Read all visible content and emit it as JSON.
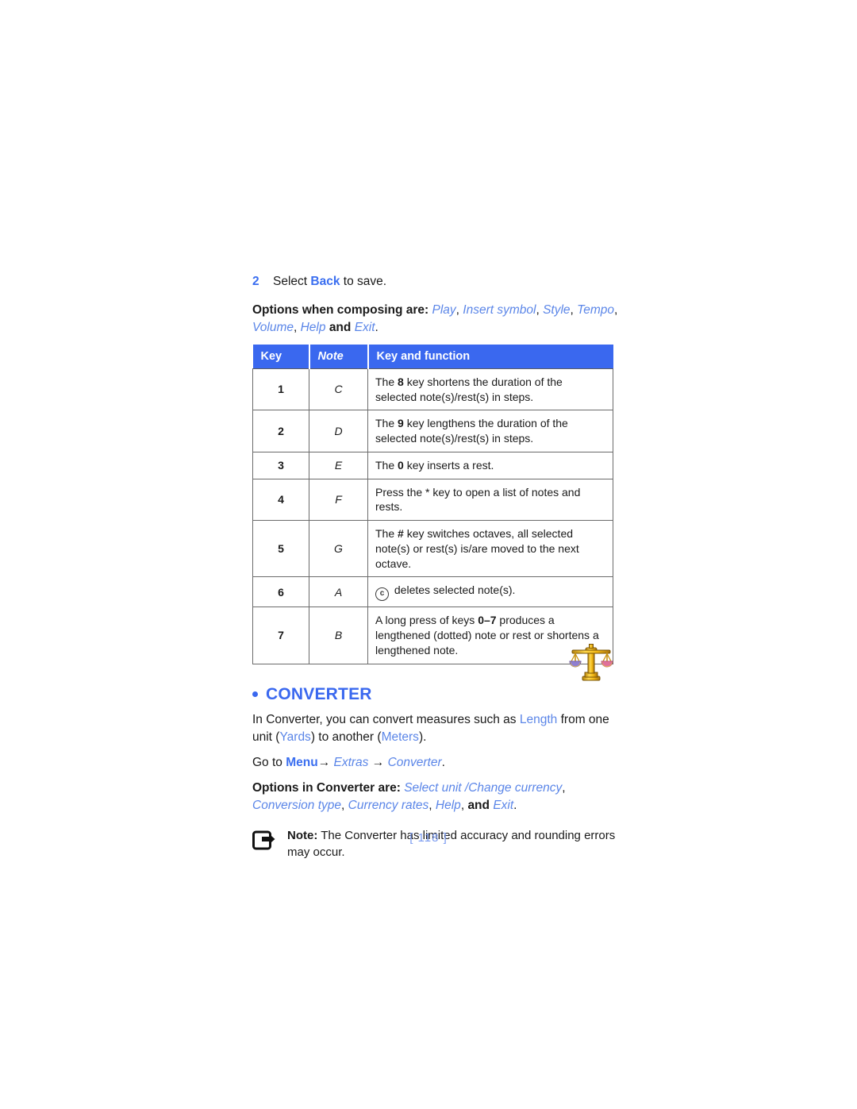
{
  "step": {
    "number": "2",
    "prefix": "Select ",
    "keyword": "Back",
    "suffix": " to save."
  },
  "options_composing": {
    "label": "Options when composing are:",
    "items": [
      "Play",
      "Insert symbol",
      "Style",
      "Tempo",
      "Volume",
      "Help",
      "Exit"
    ],
    "conjunction": "and"
  },
  "table": {
    "headers": [
      "Key",
      "Note",
      "Key and function"
    ],
    "rows": [
      {
        "key": "1",
        "note": "C",
        "fn_pre": "The ",
        "fn_bold": "8",
        "fn_post": " key shortens the duration of the selected note(s)/rest(s) in steps."
      },
      {
        "key": "2",
        "note": "D",
        "fn_pre": "The ",
        "fn_bold": "9",
        "fn_post": " key lengthens the duration of the selected note(s)/rest(s) in steps."
      },
      {
        "key": "3",
        "note": "E",
        "fn_pre": "The ",
        "fn_bold": "0",
        "fn_post": " key inserts a rest."
      },
      {
        "key": "4",
        "note": "F",
        "fn_pre": "Press the * key to open a list of notes and rests.",
        "fn_bold": "",
        "fn_post": ""
      },
      {
        "key": "5",
        "note": "G",
        "fn_pre": "The ",
        "fn_bold": "#",
        "fn_post": " key switches octaves, all selected note(s) or rest(s) is/are moved to the next octave."
      },
      {
        "key": "6",
        "note": "A",
        "fn_pre": "",
        "fn_bold": "",
        "fn_post": " deletes selected note(s).",
        "icon": "clear-key-icon"
      },
      {
        "key": "7",
        "note": "B",
        "fn_pre": "A long press of keys ",
        "fn_bold": "0–7",
        "fn_post": " produces a lengthened (dotted) note or rest or shortens a lengthened note."
      }
    ]
  },
  "converter": {
    "heading": "CONVERTER",
    "icon": "balance-scale-icon",
    "body_pre": "In Converter, you can convert measures such as ",
    "body_measure": "Length",
    "body_mid": " from one unit (",
    "body_from": "Yards",
    "body_mid2": ") to another (",
    "body_to": "Meters",
    "body_end": ").",
    "path_prefix": "Go to ",
    "path_menu": "Menu",
    "path_arrow1": "→",
    "path_extras": "Extras",
    "path_arrow2": "→",
    "path_converter": "Converter",
    "path_end": ".",
    "options_label": "Options in Converter are:",
    "options_items": [
      "Select unit",
      "Change currency",
      "Conversion type",
      "Currency rates",
      "Help",
      "Exit"
    ],
    "options_separator": "/",
    "options_conjunction": "and"
  },
  "note": {
    "icon": "note-pointer-icon",
    "label": "Note:",
    "text": " The Converter has limited accuracy and rounding errors may occur."
  },
  "page_number": "[ 118 ]",
  "colors": {
    "accent_blue": "#3a68ef",
    "light_blue": "#5b86e8",
    "page_number_blue": "#7b9bf0",
    "table_border": "#6b6b6b",
    "text": "#1a1a1a"
  }
}
